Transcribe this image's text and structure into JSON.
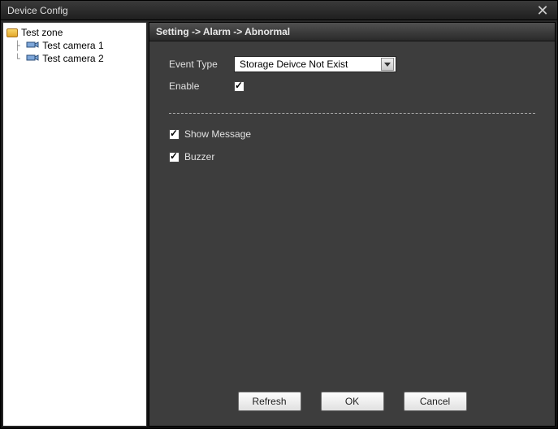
{
  "window": {
    "title": "Device Config"
  },
  "sidebar": {
    "root_label": "Test zone",
    "items": [
      {
        "label": "Test camera 1"
      },
      {
        "label": "Test camera 2"
      }
    ]
  },
  "breadcrumb": "Setting -> Alarm -> Abnormal",
  "form": {
    "event_type_label": "Event Type",
    "event_type_value": "Storage Deivce Not Exist",
    "enable_label": "Enable",
    "enable_checked": true,
    "show_message_label": "Show Message",
    "show_message_checked": true,
    "buzzer_label": "Buzzer",
    "buzzer_checked": true
  },
  "buttons": {
    "refresh": "Refresh",
    "ok": "OK",
    "cancel": "Cancel"
  }
}
